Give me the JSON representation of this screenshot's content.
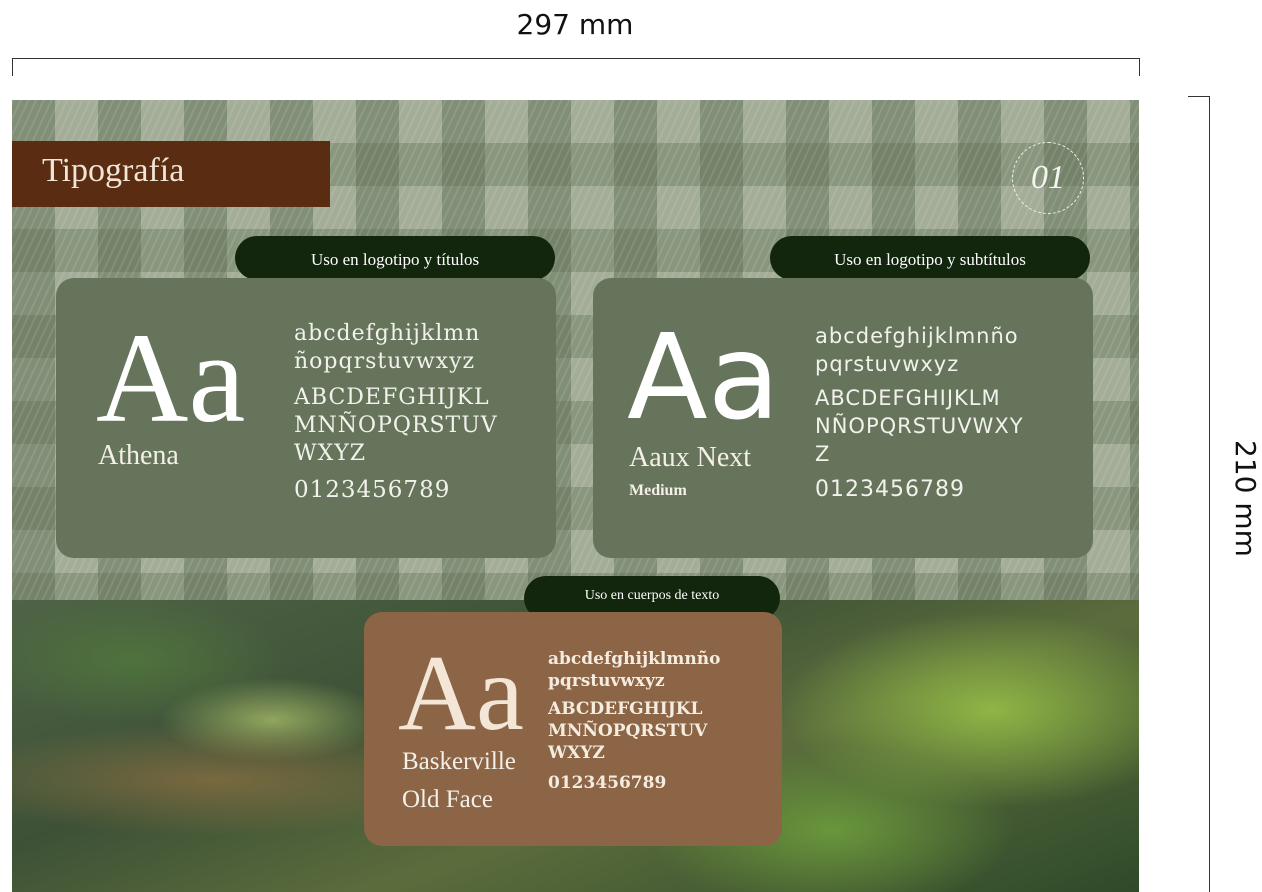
{
  "dimensions": {
    "width_label": "297 mm",
    "height_label": "210 mm"
  },
  "header": {
    "title": "Tipografía",
    "page_number": "01"
  },
  "fonts": [
    {
      "usage": "Uso en logotipo y títulos",
      "sample": "Aa",
      "name": "Athena",
      "weight": "",
      "lowercase": [
        "abcdefghijklmn",
        "ñopqrstuvwxyz"
      ],
      "uppercase": [
        "ABCDEFGHIJKL",
        "MNÑOPQRSTUV",
        "WXYZ"
      ],
      "digits": "0123456789"
    },
    {
      "usage": "Uso en logotipo y subtítulos",
      "sample": "Aa",
      "name": "Aaux Next",
      "weight": "Medium",
      "lowercase": [
        "abcdefghijklmnño",
        "pqrstuvwxyz"
      ],
      "uppercase": [
        "ABCDEFGHIJKLM",
        "NÑOPQRSTUVWXY",
        "Z"
      ],
      "digits": "0123456789"
    },
    {
      "usage": "Uso en cuerpos de texto",
      "sample": "Aa",
      "name": "Baskerville",
      "name_line2": "Old Face",
      "lowercase": [
        "abcdefghijklmnño",
        "pqrstuvwxyz"
      ],
      "uppercase": [
        "ABCDEFGHIJKL",
        "MNÑOPQRSTUV",
        "WXYZ"
      ],
      "digits": "0123456789"
    }
  ],
  "colors": {
    "title_band": "#5a2c12",
    "pill": "#12260d",
    "card_green": "#65745b",
    "card_brown": "#8c6546"
  }
}
